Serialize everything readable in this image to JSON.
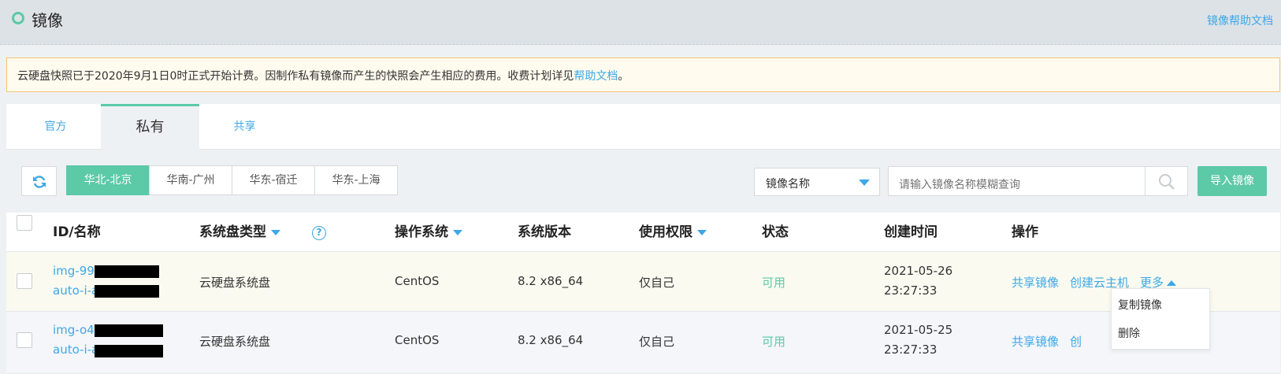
{
  "header": {
    "title": "镜像",
    "help_link": "镜像帮助文档"
  },
  "notice": {
    "text": "云硬盘快照已于2020年9月1日0时正式开始计费。因制作私有镜像而产生的快照会产生相应的费用。收费计划详见",
    "link": "帮助文档",
    "end": "。"
  },
  "tabs": [
    {
      "label": "官方"
    },
    {
      "label": "私有"
    },
    {
      "label": "共享"
    }
  ],
  "toolbar": {
    "regions": [
      {
        "label": "华北-北京"
      },
      {
        "label": "华南-广州"
      },
      {
        "label": "华东-宿迁"
      },
      {
        "label": "华东-上海"
      }
    ],
    "filter_select": "镜像名称",
    "search_placeholder": "请输入镜像名称模糊查询",
    "import_button": "导入镜像"
  },
  "table": {
    "columns": [
      "ID/名称",
      "系统盘类型",
      "操作系统",
      "系统版本",
      "使用权限",
      "状态",
      "创建时间",
      "操作"
    ],
    "rows": [
      {
        "id": "img-99l",
        "name": "auto-i-a",
        "disk_type": "云硬盘系统盘",
        "os": "CentOS",
        "version": "8.2 x86_64",
        "permission": "仅自己",
        "status": "可用",
        "date": "2021-05-26",
        "time": "23:27:33",
        "action_share": "共享镜像",
        "action_create": "创建云主机",
        "action_more": "更多"
      },
      {
        "id": "img-o4",
        "name": "auto-i-a",
        "disk_type": "云硬盘系统盘",
        "os": "CentOS",
        "version": "8.2 x86_64",
        "permission": "仅自己",
        "status": "可用",
        "date": "2021-05-25",
        "time": "23:27:33",
        "action_share": "共享镜像",
        "action_create": "创"
      }
    ]
  },
  "more_menu": [
    {
      "label": "复制镜像"
    },
    {
      "label": "删除"
    }
  ],
  "colors": {
    "accent_green": "#5cc9a7",
    "link_blue": "#3da8e6",
    "notice_border": "#f5c571"
  }
}
